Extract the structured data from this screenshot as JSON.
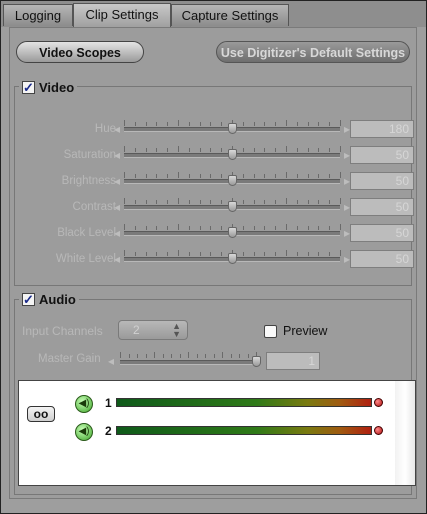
{
  "tabs": [
    {
      "label": "Logging",
      "active": false
    },
    {
      "label": "Clip Settings",
      "active": true
    },
    {
      "label": "Capture Settings",
      "active": false
    }
  ],
  "buttons": {
    "video_scopes": "Video Scopes",
    "digitizer_defaults": "Use Digitizer's Default Settings"
  },
  "video": {
    "title": "Video",
    "checked": true,
    "sliders": [
      {
        "label": "Hue",
        "value": "180",
        "level": 0.5
      },
      {
        "label": "Saturation",
        "value": "50",
        "level": 0.5
      },
      {
        "label": "Brightness",
        "value": "50",
        "level": 0.5
      },
      {
        "label": "Contrast",
        "value": "50",
        "level": 0.5
      },
      {
        "label": "Black Level",
        "value": "50",
        "level": 0.5
      },
      {
        "label": "White Level",
        "value": "50",
        "level": 0.5
      }
    ],
    "minus_glyph": "◂",
    "plus_glyph": "▸"
  },
  "audio": {
    "title": "Audio",
    "checked": true,
    "input_channels_label": "Input Channels",
    "input_channels_value": "2",
    "preview_label": "Preview",
    "preview_checked": false,
    "master_gain_label": "Master Gain",
    "master_gain_value": "1",
    "master_gain_level": 1.0,
    "meters": [
      {
        "channel": "1"
      },
      {
        "channel": "2"
      }
    ],
    "link_glyph": "oo"
  },
  "colors": {
    "accent": "#1a2a8a",
    "meter_clip": "#b01010"
  }
}
